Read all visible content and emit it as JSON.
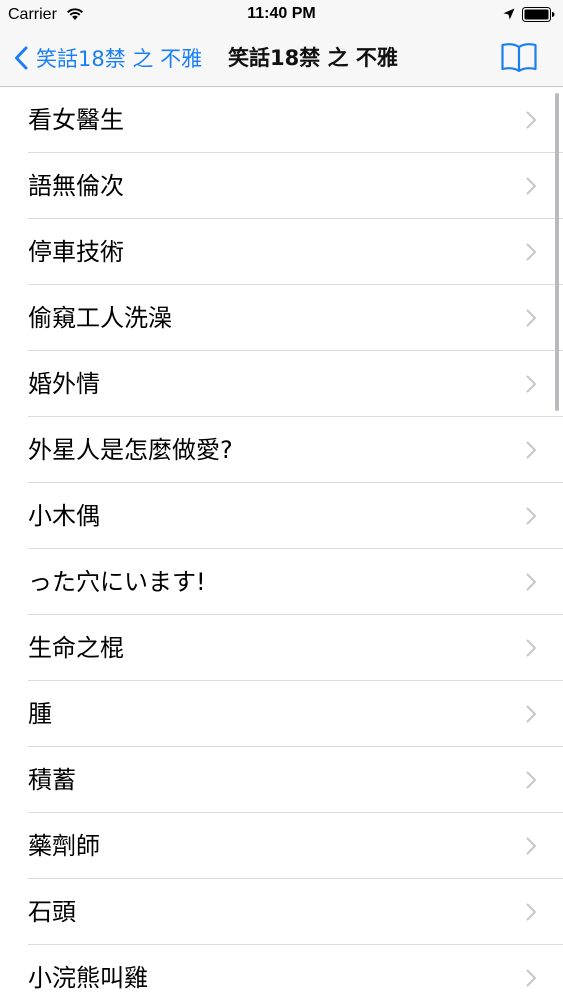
{
  "status_bar": {
    "carrier": "Carrier",
    "time": "11:40 PM"
  },
  "nav": {
    "back_label": "笑話18禁 之 不雅",
    "title": "笑話18禁 之 不雅",
    "accent_color": "#1a7ff5"
  },
  "list": {
    "items": [
      {
        "label": "看女醫生"
      },
      {
        "label": "語無倫次"
      },
      {
        "label": "停車技術"
      },
      {
        "label": "偷窺工人洗澡"
      },
      {
        "label": "婚外情"
      },
      {
        "label": "外星人是怎麼做愛?"
      },
      {
        "label": "小木偶"
      },
      {
        "label": "った穴にいます!"
      },
      {
        "label": "生命之棍"
      },
      {
        "label": "腫"
      },
      {
        "label": "積蓄"
      },
      {
        "label": "藥劑師"
      },
      {
        "label": "石頭"
      },
      {
        "label": "小浣熊叫雞"
      }
    ]
  },
  "icons": {
    "back": "chevron-left-icon",
    "bookmarks": "book-icon",
    "row_disclosure": "chevron-right-icon"
  }
}
